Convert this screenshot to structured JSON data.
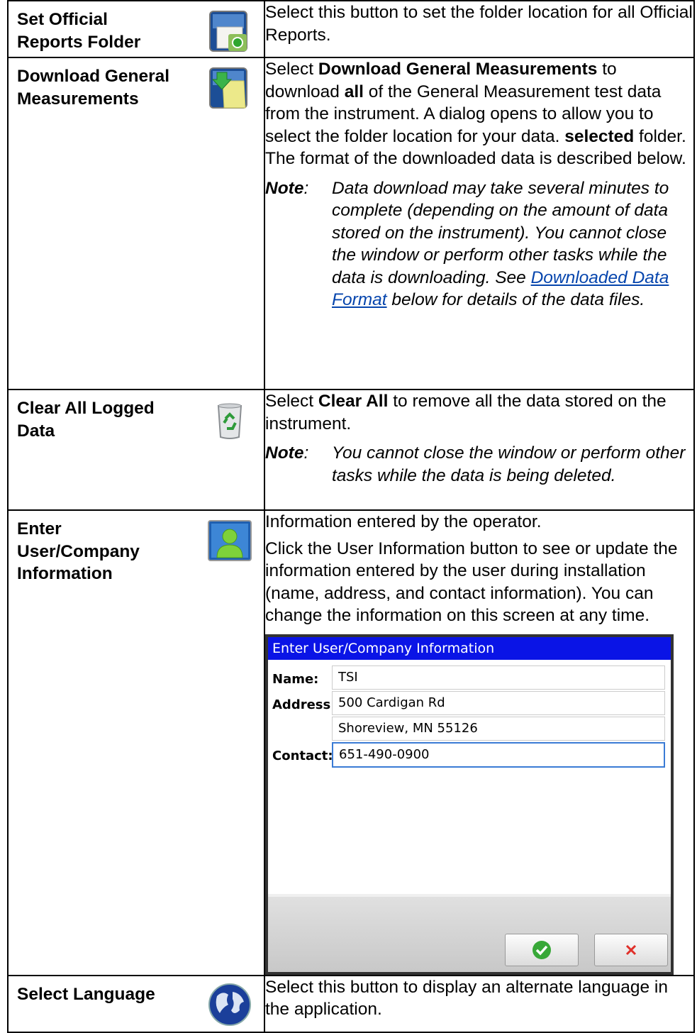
{
  "rows": [
    {
      "title": "Set Official Reports Folder",
      "icon": "folder-camera-icon",
      "desc": "Select this button to set the folder location for all Official Reports."
    },
    {
      "title": "Download General Measurements",
      "icon": "download-folder-icon",
      "desc_parts": {
        "p1": "Select ",
        "b1": "Download General Measurements",
        "p2": " to download ",
        "b2": "all",
        "p3": " of the General Measurement test data from the instrument. A dialog opens to allow you to select the folder location for your data. ",
        "b3": "selected",
        "p4": " folder. The format of the downloaded data is described below."
      },
      "note_label": "Note",
      "note_colon": ":",
      "note_text": "Data download may take several minutes to complete (depending on the amount of data stored on the instrument). You cannot close the window or perform other tasks while the data is downloading. See ",
      "note_link": "Downloaded Data Format",
      "note_tail": " below for details of the data files."
    },
    {
      "title": "Clear All Logged Data",
      "icon": "recycle-bin-icon",
      "desc_parts": {
        "p1": "Select ",
        "b1": "Clear All",
        "p2": " to remove all the data stored on the instrument."
      },
      "note_label": "Note",
      "note_colon": ":",
      "note_text": "You cannot close the window or perform other tasks while the data is being deleted."
    },
    {
      "title": "Enter User/Company Information",
      "icon": "user-icon",
      "desc1": "Information entered by the operator.",
      "desc2": "Click the User Information button to see or update the information entered by the user during installation (name, address, and contact information). You can change the information on this screen at any time.",
      "dialog": {
        "title": "Enter User/Company Information",
        "name_label": "Name:",
        "name_value": "TSI",
        "address_label": "Address:",
        "address1": "500 Cardigan Rd",
        "address2": "Shoreview, MN 55126",
        "contact_label": "Contact:",
        "contact_value": "651-490-0900"
      }
    },
    {
      "title": "Select Language",
      "icon": "globe-icon",
      "desc": "Select this button to display an alternate language in the application."
    }
  ]
}
